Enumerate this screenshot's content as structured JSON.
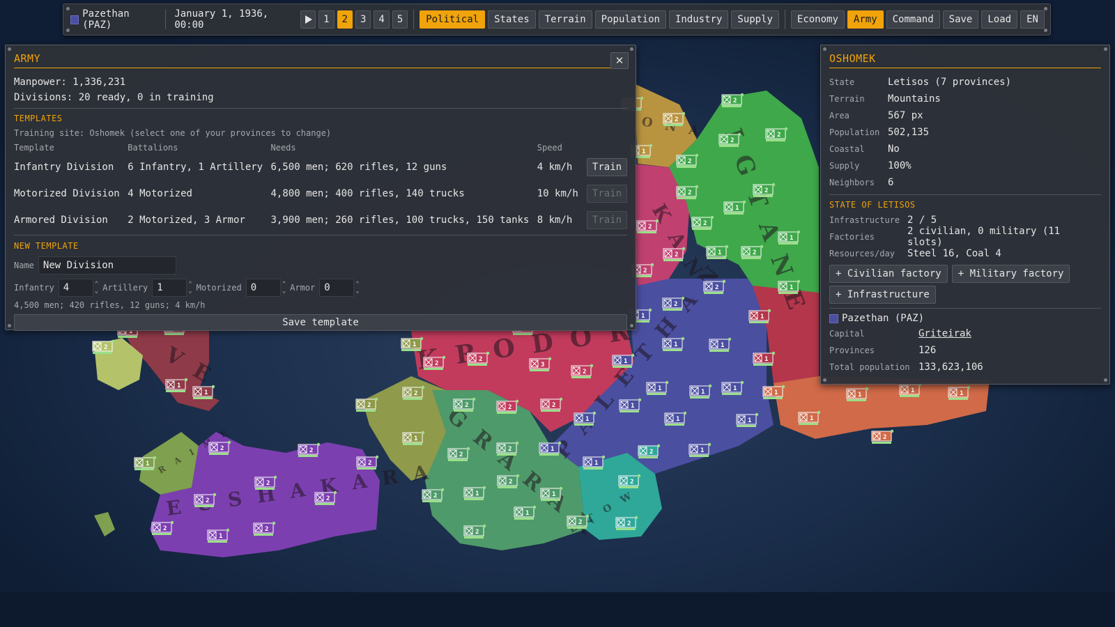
{
  "topbar": {
    "nation": "Pazethan (PAZ)",
    "nation_color": "#4b4fa0",
    "date": "January 1, 1936, 00:00",
    "play_icon": "play-icon",
    "speeds": [
      "1",
      "2",
      "3",
      "4",
      "5"
    ],
    "active_speed": "2",
    "map_modes": [
      "Political",
      "States",
      "Terrain",
      "Population",
      "Industry",
      "Supply"
    ],
    "active_map_mode": "Political",
    "menus": [
      "Economy",
      "Army",
      "Command",
      "Save",
      "Load",
      "EN"
    ],
    "active_menu": "Army"
  },
  "army": {
    "title": "ARMY",
    "close_icon": "close-icon",
    "manpower": "Manpower: 1,336,231",
    "divisions": "Divisions: 20 ready, 0 in training",
    "templates_title": "TEMPLATES",
    "training_site": "Training site: Oshomek (select one of your provinces to change)",
    "headers": {
      "template": "Template",
      "battalions": "Battalions",
      "needs": "Needs",
      "speed": "Speed"
    },
    "templates": [
      {
        "name": "Infantry Division",
        "battalions": "6 Infantry, 1 Artillery",
        "needs": "6,500 men; 620 rifles, 12 guns",
        "speed": "4 km/h",
        "train": "Train",
        "enabled": true
      },
      {
        "name": "Motorized Division",
        "battalions": "4 Motorized",
        "needs": "4,800 men; 400 rifles, 140 trucks",
        "speed": "10 km/h",
        "train": "Train",
        "enabled": false
      },
      {
        "name": "Armored Division",
        "battalions": "2 Motorized, 3 Armor",
        "needs": "3,900 men; 260 rifles, 100 trucks, 150 tanks",
        "speed": "8 km/h",
        "train": "Train",
        "enabled": false
      }
    ],
    "new_template_title": "NEW TEMPLATE",
    "name_label": "Name",
    "name_value": "New Division",
    "fields": [
      {
        "label": "Infantry",
        "value": "4"
      },
      {
        "label": "Artillery",
        "value": "1"
      },
      {
        "label": "Motorized",
        "value": "0"
      },
      {
        "label": "Armor",
        "value": "0"
      }
    ],
    "summary": "4,500 men; 420 rifles, 12 guns; 4 km/h",
    "save_label": "Save template"
  },
  "province": {
    "title": "OSHOMEK",
    "rows": [
      {
        "k": "State",
        "v": "Letisos (7 provinces)"
      },
      {
        "k": "Terrain",
        "v": "Mountains"
      },
      {
        "k": "Area",
        "v": "567 px"
      },
      {
        "k": "Population",
        "v": "502,135"
      },
      {
        "k": "Coastal",
        "v": "No"
      },
      {
        "k": "Supply",
        "v": "100%"
      },
      {
        "k": "Neighbors",
        "v": "6"
      }
    ],
    "state_title": "STATE OF LETISOS",
    "state_rows": [
      {
        "k": "Infrastructure",
        "v": "2 / 5"
      },
      {
        "k": "Factories",
        "v": "2 civilian, 0 military (11 slots)"
      },
      {
        "k": "Resources/day",
        "v": "Steel 16, Coal 4"
      }
    ],
    "actions": [
      "+ Civilian factory",
      "+ Military factory",
      "+ Infrastructure"
    ],
    "owner": "Pazethan (PAZ)",
    "owner_color": "#4b4fa0",
    "owner_rows": [
      {
        "k": "Capital",
        "v": "Griteirak",
        "link": true
      },
      {
        "k": "Provinces",
        "v": "126"
      },
      {
        "k": "Total population",
        "v": "133,623,106"
      }
    ]
  },
  "map": {
    "labels": [
      "K R O D O R",
      "E U S H A K A R A",
      "G R A R A K",
      "R A I M E",
      "P A L E T H A N",
      "V E",
      "I G T A N E",
      "K A N",
      "O N A",
      "B T O W"
    ],
    "units": [
      {
        "n": "2",
        "c": "#8f3a48"
      },
      {
        "n": "1",
        "c": "#8f3a48"
      },
      {
        "n": "1",
        "c": "#8f3a48"
      },
      {
        "n": "1",
        "c": "#8f3a48"
      },
      {
        "n": "2",
        "c": "#b4c36a"
      },
      {
        "n": "2",
        "c": "#7c3fb0"
      },
      {
        "n": "2",
        "c": "#7c3fb0"
      },
      {
        "n": "2",
        "c": "#7c3fb0"
      },
      {
        "n": "2",
        "c": "#7c3fb0"
      },
      {
        "n": "2",
        "c": "#7c3fb0"
      },
      {
        "n": "2",
        "c": "#7c3fb0"
      },
      {
        "n": "2",
        "c": "#7c3fb0"
      },
      {
        "n": "1",
        "c": "#7c3fb0"
      },
      {
        "n": "2",
        "c": "#7c3fb0"
      },
      {
        "n": "1",
        "c": "#7fa04e"
      },
      {
        "n": "2",
        "c": "#c23b5c"
      },
      {
        "n": "2",
        "c": "#c23b5c"
      },
      {
        "n": "3",
        "c": "#c23b5c"
      },
      {
        "n": "2",
        "c": "#c23b5c"
      },
      {
        "n": "2",
        "c": "#c23b5c"
      },
      {
        "n": "2",
        "c": "#c23b5c"
      },
      {
        "n": "2",
        "c": "#c23b5c"
      },
      {
        "n": "1",
        "c": "#8f9a4a"
      },
      {
        "n": "2",
        "c": "#8f9a4a"
      },
      {
        "n": "2",
        "c": "#8f9a4a"
      },
      {
        "n": "1",
        "c": "#8f9a4a"
      },
      {
        "n": "2",
        "c": "#4f9a6a"
      },
      {
        "n": "2",
        "c": "#4f9a6a"
      },
      {
        "n": "2",
        "c": "#4f9a6a"
      },
      {
        "n": "2",
        "c": "#4f9a6a"
      },
      {
        "n": "1",
        "c": "#4f9a6a"
      },
      {
        "n": "2",
        "c": "#4f9a6a"
      },
      {
        "n": "1",
        "c": "#4f9a6a"
      },
      {
        "n": "1",
        "c": "#4f9a6a"
      },
      {
        "n": "2",
        "c": "#4f9a6a"
      },
      {
        "n": "2",
        "c": "#4f9a6a"
      },
      {
        "n": "2",
        "c": "#2fa89a"
      },
      {
        "n": "2",
        "c": "#2fa89a"
      },
      {
        "n": "2",
        "c": "#2fa89a"
      },
      {
        "n": "1",
        "c": "#4b4fa0"
      },
      {
        "n": "1",
        "c": "#4b4fa0"
      },
      {
        "n": "1",
        "c": "#4b4fa0"
      },
      {
        "n": "1",
        "c": "#4b4fa0"
      },
      {
        "n": "1",
        "c": "#4b4fa0"
      },
      {
        "n": "1",
        "c": "#4b4fa0"
      },
      {
        "n": "1",
        "c": "#4b4fa0"
      },
      {
        "n": "1",
        "c": "#4b4fa0"
      },
      {
        "n": "1",
        "c": "#4b4fa0"
      },
      {
        "n": "1",
        "c": "#4b4fa0"
      },
      {
        "n": "1",
        "c": "#4b4fa0"
      },
      {
        "n": "2",
        "c": "#4b4fa0"
      },
      {
        "n": "2",
        "c": "#4b4fa0"
      },
      {
        "n": "1",
        "c": "#4b4fa0"
      },
      {
        "n": "1",
        "c": "#4b4fa0"
      },
      {
        "n": "1",
        "c": "#4b4fa0"
      },
      {
        "n": "2",
        "c": "#c04070"
      },
      {
        "n": "2",
        "c": "#c04070"
      },
      {
        "n": "2",
        "c": "#c04070"
      },
      {
        "n": "1",
        "c": "#b89440"
      },
      {
        "n": "2",
        "c": "#b89440"
      },
      {
        "n": "2",
        "c": "#b89440"
      },
      {
        "n": "2",
        "c": "#3fa84a"
      },
      {
        "n": "2",
        "c": "#3fa84a"
      },
      {
        "n": "2",
        "c": "#3fa84a"
      },
      {
        "n": "2",
        "c": "#3fa84a"
      },
      {
        "n": "2",
        "c": "#3fa84a"
      },
      {
        "n": "2",
        "c": "#3fa84a"
      },
      {
        "n": "1",
        "c": "#3fa84a"
      },
      {
        "n": "1",
        "c": "#3fa84a"
      },
      {
        "n": "2",
        "c": "#3fa84a"
      },
      {
        "n": "2",
        "c": "#3fa84a"
      },
      {
        "n": "1",
        "c": "#3fa84a"
      },
      {
        "n": "1",
        "c": "#3fa84a"
      },
      {
        "n": "1",
        "c": "#b3364a"
      },
      {
        "n": "1",
        "c": "#b3364a"
      },
      {
        "n": "1",
        "c": "#d06a48"
      },
      {
        "n": "1",
        "c": "#d06a48"
      },
      {
        "n": "1",
        "c": "#d06a48"
      },
      {
        "n": "1",
        "c": "#d06a48"
      },
      {
        "n": "1",
        "c": "#d06a48"
      },
      {
        "n": "2",
        "c": "#d06a48"
      }
    ],
    "colors": {
      "sea": "#1a2d4a",
      "kroror": "#c23b5c",
      "eushakara": "#7c3fb0",
      "grarak": "#4f9a6a",
      "paleth": "#4b4fa0",
      "igtane": "#3fa84a",
      "kan": "#c04070",
      "ona": "#b89440",
      "ve": "#8f3a48",
      "olive": "#8f9a4a",
      "teal": "#2fa89a",
      "orange": "#d06a48",
      "red": "#b3364a",
      "raime": "#7fa04e"
    }
  }
}
